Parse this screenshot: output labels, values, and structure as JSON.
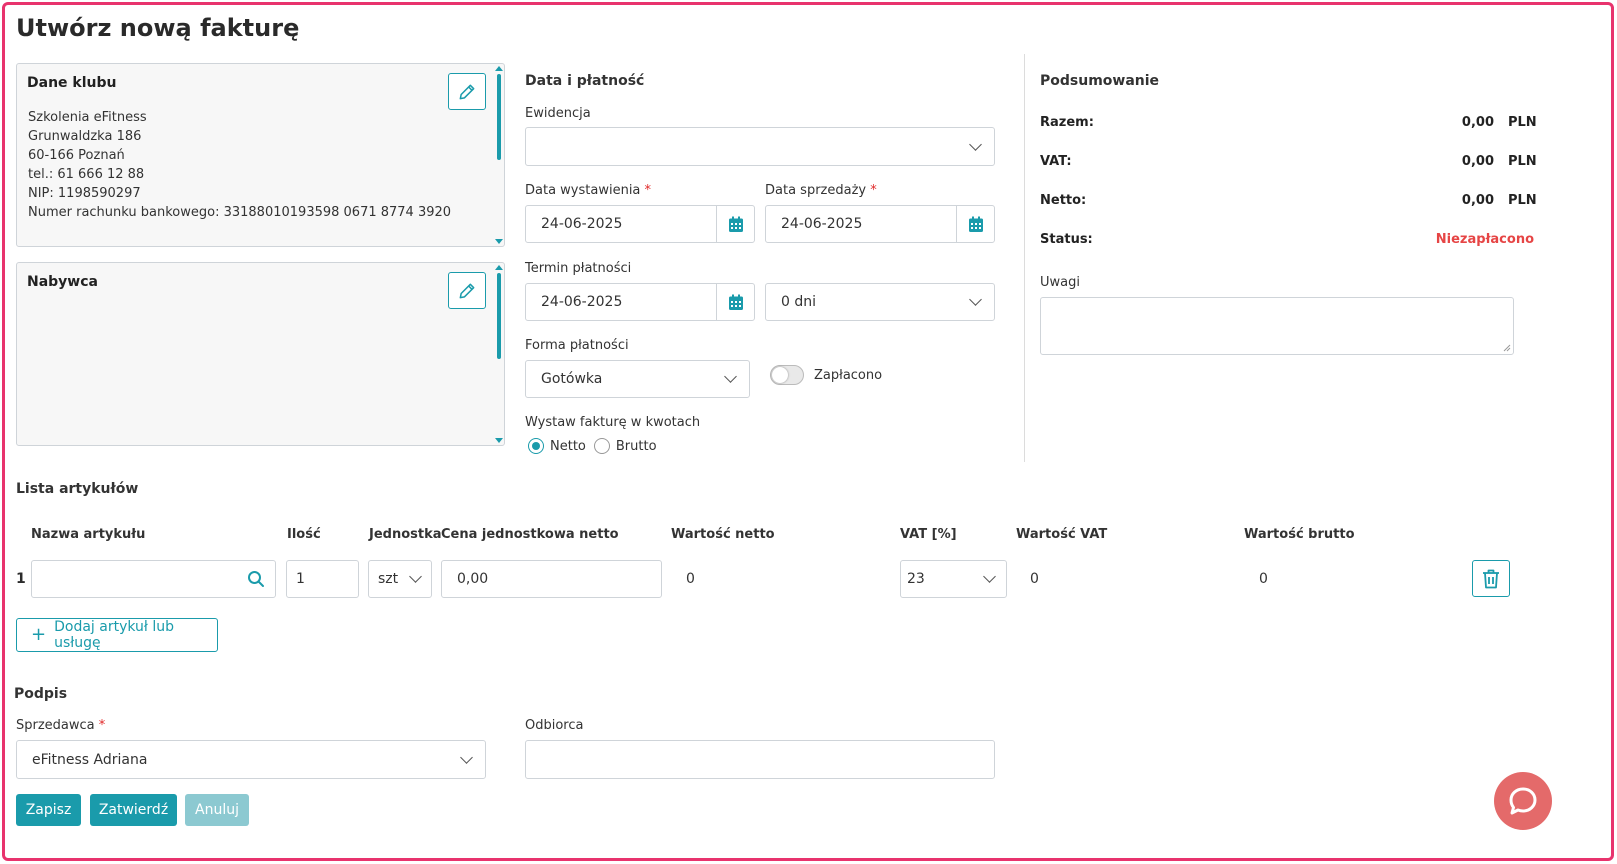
{
  "page": {
    "title": "Utwórz nową fakturę"
  },
  "club": {
    "title": "Dane klubu",
    "lines": [
      "Szkolenia eFitness",
      "Grunwaldzka 186",
      "60-166 Poznań",
      "tel.: 61 666 12 88",
      "NIP: 1198590297",
      "Numer rachunku bankowego: 33188010193598 0671 8774 3920"
    ]
  },
  "buyer": {
    "title": "Nabywca"
  },
  "payment": {
    "title": "Data i płatność",
    "ewidencja_label": "Ewidencja",
    "ewidencja_value": "",
    "issue_date_label": "Data wystawienia",
    "issue_date": "24-06-2025",
    "sale_date_label": "Data sprzedaży",
    "sale_date": "24-06-2025",
    "due_label": "Termin płatności",
    "due_date": "24-06-2025",
    "due_days": "0 dni",
    "method_label": "Forma płatności",
    "method": "Gotówka",
    "paid_label": "Zapłacono",
    "paid": false,
    "amounts_label": "Wystaw fakturę w kwotach",
    "opt_net": "Netto",
    "opt_gross": "Brutto",
    "selected": "Netto",
    "required_mark": "*"
  },
  "summary": {
    "title": "Podsumowanie",
    "total_label": "Razem:",
    "total": "0,00",
    "vat_label": "VAT:",
    "vat": "0,00",
    "net_label": "Netto:",
    "net": "0,00",
    "currency": "PLN",
    "status_label": "Status:",
    "status": "Niezapłacono",
    "notes_label": "Uwagi",
    "status_color": "#e64545"
  },
  "items": {
    "title": "Lista artykułów",
    "headers": {
      "name": "Nazwa artykułu",
      "qty": "Ilość",
      "unit": "Jednostka",
      "unit_price": "Cena jednostkowa netto",
      "net_value": "Wartość netto",
      "vat": "VAT [%]",
      "vat_value": "Wartość VAT",
      "gross_value": "Wartość brutto"
    },
    "rows": [
      {
        "index": "1",
        "name": "",
        "qty": "1",
        "unit": "szt",
        "unit_price": "0,00",
        "net_value": "0",
        "vat": "23",
        "vat_value": "0",
        "gross_value": "0"
      }
    ],
    "add_label": "Dodaj artykuł lub usługę"
  },
  "signature": {
    "title": "Podpis",
    "seller_label": "Sprzedawca",
    "seller": "eFitness Adriana",
    "receiver_label": "Odbiorca",
    "receiver": ""
  },
  "actions": {
    "save": "Zapisz",
    "confirm": "Zatwierdź",
    "cancel": "Anuluj"
  },
  "colors": {
    "accent": "#1a9bab",
    "frame": "#e8336d",
    "chat": "#e46a6a"
  }
}
